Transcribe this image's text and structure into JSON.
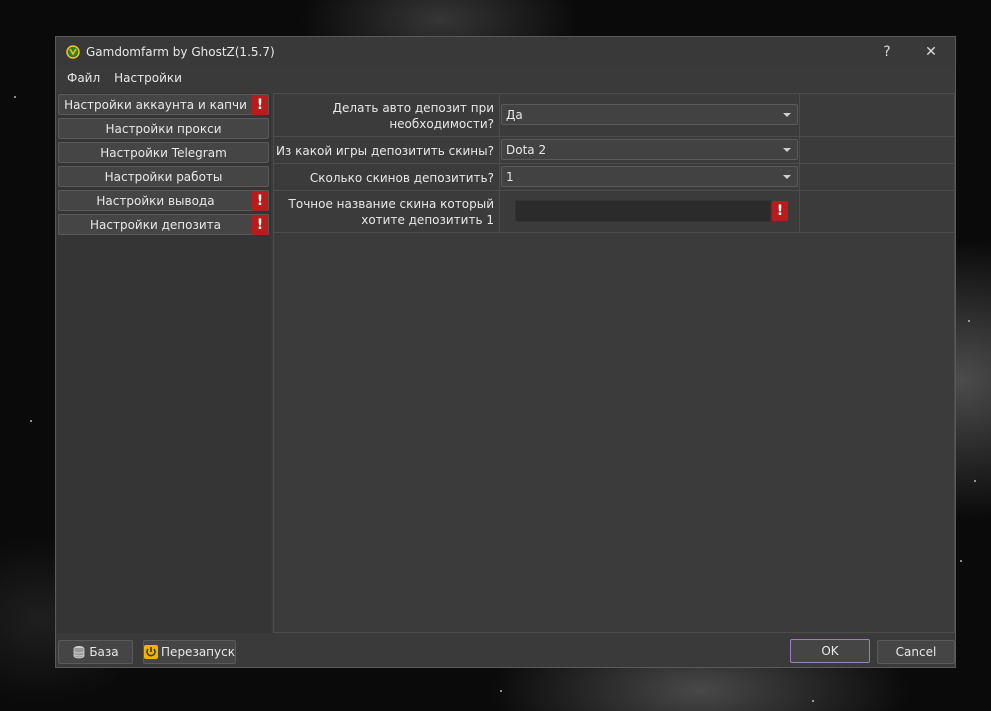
{
  "window": {
    "title": "Gamdomfarm by GhostZ(1.5.7)",
    "help_label": "?",
    "close_label": "✕"
  },
  "menu": [
    "Файл",
    "Настройки"
  ],
  "sidebar": {
    "items": [
      {
        "label": "Настройки аккаунта и капчи",
        "warning": true
      },
      {
        "label": "Настройки прокси",
        "warning": false
      },
      {
        "label": "Настройки Telegram",
        "warning": false
      },
      {
        "label": "Настройки работы",
        "warning": false
      },
      {
        "label": "Настройки вывода",
        "warning": true
      },
      {
        "label": "Настройки депозита",
        "warning": true
      }
    ],
    "warning_glyph": "!"
  },
  "settings": {
    "rows": [
      {
        "label_line1": "Делать авто депозит при",
        "label_line2": "необходимости?",
        "value": "Да"
      },
      {
        "label": "Из какой игры депозитить скины?",
        "value": "Dota 2"
      },
      {
        "label": "Сколько скинов депозитить?",
        "value": "1"
      },
      {
        "label_line1": "Точное название скина который",
        "label_line2": "хотите депозитить 1",
        "value": ""
      }
    ]
  },
  "footer": {
    "base_label": "База",
    "restart_label": "Перезапуск",
    "ok_label": "OK",
    "cancel_label": "Cancel"
  },
  "icons": {
    "app": "app-icon",
    "warning": "warning-icon",
    "database": "database-icon",
    "restart": "restart-icon",
    "dropdown": "chevron-down-icon"
  },
  "colors": {
    "warning_red": "#b81c1c",
    "ok_border": "#9b7fbf"
  }
}
